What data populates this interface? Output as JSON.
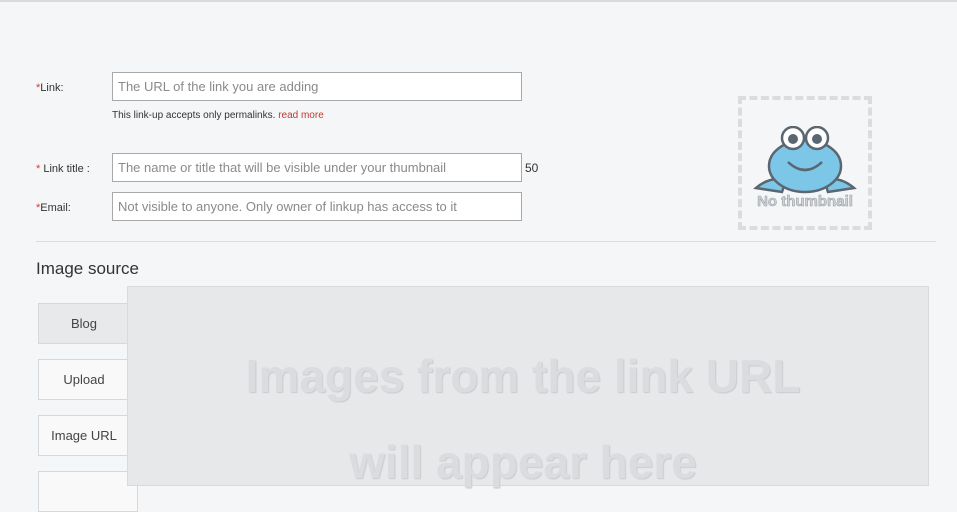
{
  "form": {
    "link": {
      "required_mark": "*",
      "label": "Link:",
      "placeholder": "The URL of the link you are adding",
      "hint_text": "This link-up accepts only permalinks.",
      "hint_link": "read more"
    },
    "title": {
      "required_mark": "*",
      "label": " Link title :",
      "placeholder": "The name or title that will be visible under your thumbnail",
      "counter": "50"
    },
    "email": {
      "required_mark": "*",
      "label": "Email:",
      "placeholder": "Not visible to anyone. Only owner of linkup has access to it"
    }
  },
  "thumbnail": {
    "text": "No thumbnail",
    "icon": "frog-icon",
    "frog_color": "#7cc7e8"
  },
  "image_source": {
    "title": "Image source",
    "tabs": [
      {
        "label": "Blog",
        "active": true
      },
      {
        "label": "Upload",
        "active": false
      },
      {
        "label": "Image URL",
        "active": false
      },
      {
        "label": "",
        "active": false
      }
    ],
    "preview_line1": "Images from the link URL",
    "preview_line2": "will appear here"
  }
}
